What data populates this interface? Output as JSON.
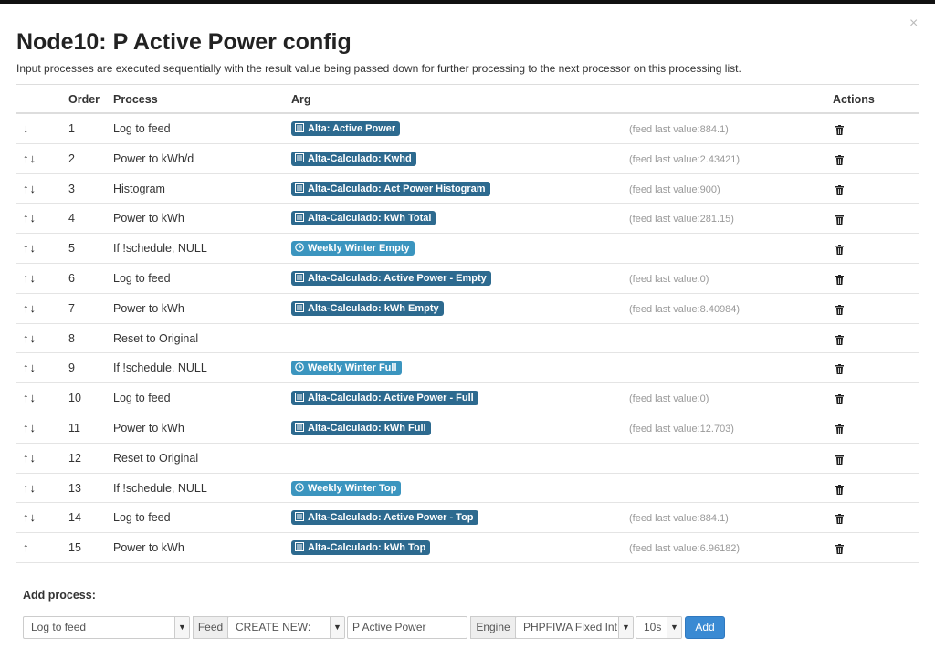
{
  "modal": {
    "title_bold": "Node10: P Active Power",
    "title_rest": "config",
    "close_label": "×",
    "description": "Input processes are executed sequentially with the result value being passed down for further processing to the next processor on this processing list."
  },
  "table": {
    "headers": {
      "order": "Order",
      "process": "Process",
      "arg": "Arg",
      "actions": "Actions"
    },
    "rows": [
      {
        "arrows": "↓",
        "order": "1",
        "process": "Log to feed",
        "arg": "Alta: Active Power",
        "arg_type": "feed",
        "feed_value": "(feed last value:884.1)"
      },
      {
        "arrows": "↑↓",
        "order": "2",
        "process": "Power to kWh/d",
        "arg": "Alta-Calculado: Kwhd",
        "arg_type": "feed",
        "feed_value": "(feed last value:2.43421)"
      },
      {
        "arrows": "↑↓",
        "order": "3",
        "process": "Histogram",
        "arg": "Alta-Calculado: Act Power Histogram",
        "arg_type": "feed",
        "feed_value": "(feed last value:900)"
      },
      {
        "arrows": "↑↓",
        "order": "4",
        "process": "Power to kWh",
        "arg": "Alta-Calculado: kWh Total",
        "arg_type": "feed",
        "feed_value": "(feed last value:281.15)"
      },
      {
        "arrows": "↑↓",
        "order": "5",
        "process": "If !schedule, NULL",
        "arg": "Weekly Winter Empty",
        "arg_type": "schedule",
        "feed_value": ""
      },
      {
        "arrows": "↑↓",
        "order": "6",
        "process": "Log to feed",
        "arg": "Alta-Calculado: Active Power - Empty",
        "arg_type": "feed",
        "feed_value": "(feed last value:0)"
      },
      {
        "arrows": "↑↓",
        "order": "7",
        "process": "Power to kWh",
        "arg": "Alta-Calculado: kWh Empty",
        "arg_type": "feed",
        "feed_value": "(feed last value:8.40984)"
      },
      {
        "arrows": "↑↓",
        "order": "8",
        "process": "Reset to Original",
        "arg": "",
        "arg_type": "none",
        "feed_value": ""
      },
      {
        "arrows": "↑↓",
        "order": "9",
        "process": "If !schedule, NULL",
        "arg": "Weekly Winter Full",
        "arg_type": "schedule",
        "feed_value": ""
      },
      {
        "arrows": "↑↓",
        "order": "10",
        "process": "Log to feed",
        "arg": "Alta-Calculado: Active Power - Full",
        "arg_type": "feed",
        "feed_value": "(feed last value:0)"
      },
      {
        "arrows": "↑↓",
        "order": "11",
        "process": "Power to kWh",
        "arg": "Alta-Calculado: kWh Full",
        "arg_type": "feed",
        "feed_value": "(feed last value:12.703)"
      },
      {
        "arrows": "↑↓",
        "order": "12",
        "process": "Reset to Original",
        "arg": "",
        "arg_type": "none",
        "feed_value": ""
      },
      {
        "arrows": "↑↓",
        "order": "13",
        "process": "If !schedule, NULL",
        "arg": "Weekly Winter Top",
        "arg_type": "schedule",
        "feed_value": ""
      },
      {
        "arrows": "↑↓",
        "order": "14",
        "process": "Log to feed",
        "arg": "Alta-Calculado: Active Power - Top",
        "arg_type": "feed",
        "feed_value": "(feed last value:884.1)"
      },
      {
        "arrows": "↑",
        "order": "15",
        "process": "Power to kWh",
        "arg": "Alta-Calculado: kWh Top",
        "arg_type": "feed",
        "feed_value": "(feed last value:6.96182)"
      }
    ]
  },
  "add_process": {
    "label": "Add process:",
    "process_select": "Log to feed",
    "feed_label": "Feed",
    "feed_select": "CREATE NEW:",
    "feed_name_value": "P Active Power",
    "engine_label": "Engine",
    "engine_select": "PHPFIWA Fixed Int",
    "interval_select": "10s",
    "add_button": "Add"
  },
  "colors": {
    "feed_label_bg": "#2d6a8f",
    "schedule_label_bg": "#3b95bf",
    "add_button_bg": "#3a8ad3"
  },
  "icons": {
    "feed": "list-alt-icon",
    "schedule": "clock-icon",
    "delete": "trash-icon",
    "dropdown": "chevron-down-icon"
  }
}
